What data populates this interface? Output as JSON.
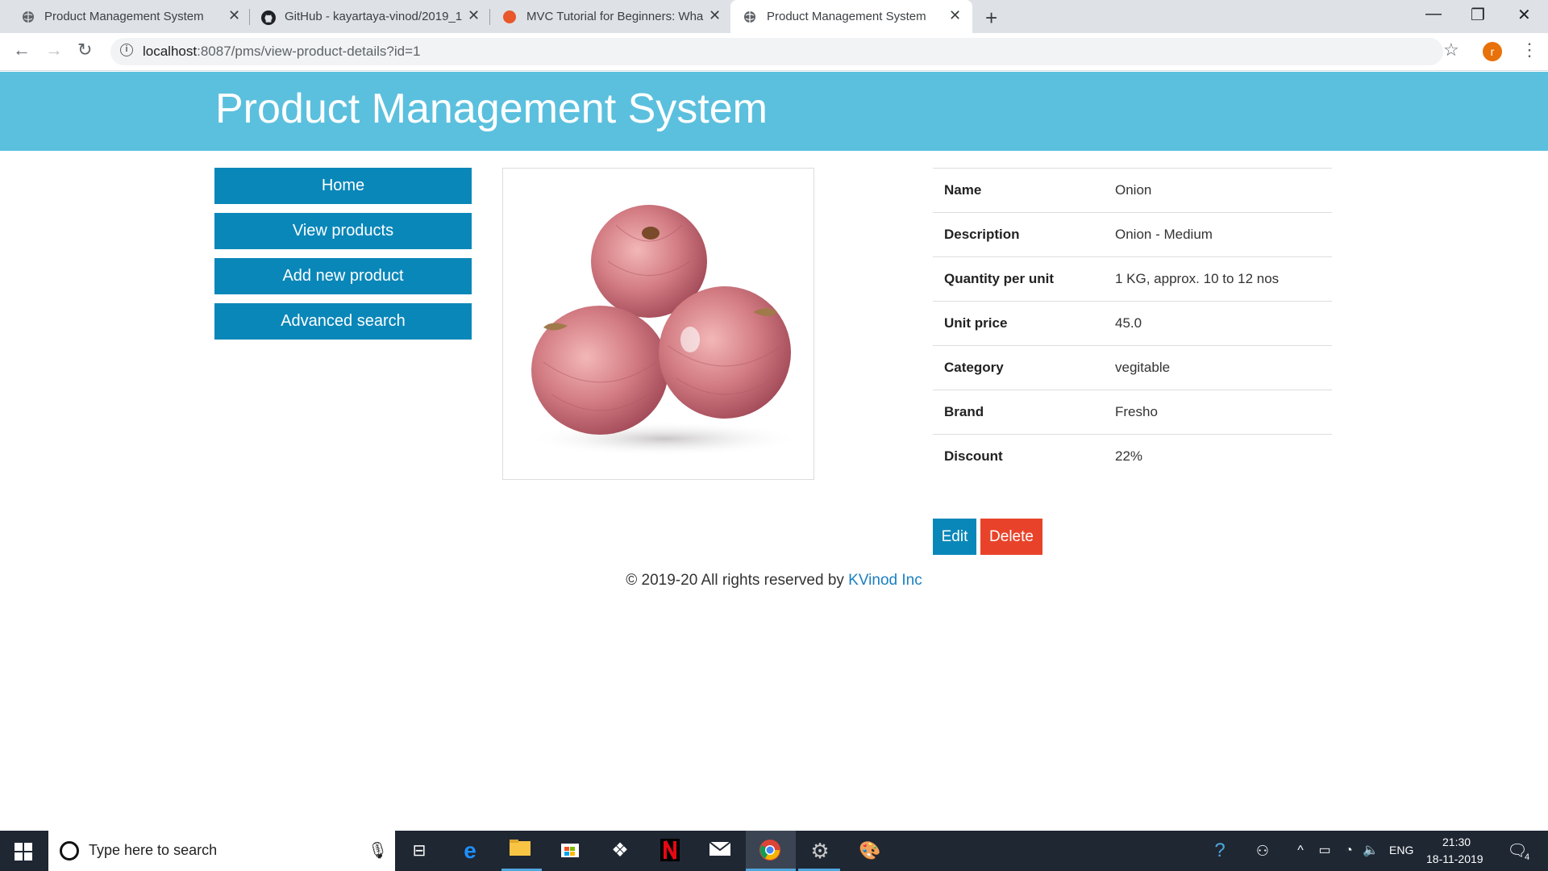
{
  "browser": {
    "tabs": [
      {
        "title": "Product Management System",
        "favicon": "globe-icon"
      },
      {
        "title": "GitHub - kayartaya-vinod/2019_1",
        "favicon": "github-icon"
      },
      {
        "title": "MVC Tutorial for Beginners: Wha",
        "favicon": "guru99-icon"
      },
      {
        "title": "Product Management System",
        "favicon": "globe-icon",
        "active": true
      }
    ],
    "url_host": "localhost",
    "url_rest": ":8087/pms/view-product-details?id=1",
    "profile_initial": "r"
  },
  "header": {
    "title": "Product Management System"
  },
  "sidebar": {
    "items": [
      {
        "label": "Home"
      },
      {
        "label": "View products"
      },
      {
        "label": "Add new product"
      },
      {
        "label": "Advanced search"
      }
    ]
  },
  "product": {
    "rows": [
      {
        "label": "Name",
        "value": "Onion"
      },
      {
        "label": "Description",
        "value": "Onion - Medium"
      },
      {
        "label": "Quantity per unit",
        "value": "1 KG, approx. 10 to 12 nos"
      },
      {
        "label": "Unit price",
        "value": "45.0"
      },
      {
        "label": "Category",
        "value": "vegitable"
      },
      {
        "label": "Brand",
        "value": "Fresho"
      },
      {
        "label": "Discount",
        "value": "22%"
      }
    ]
  },
  "actions": {
    "edit_label": "Edit",
    "delete_label": "Delete"
  },
  "footer": {
    "text": "© 2019-20 All rights reserved by ",
    "link": "KVinod Inc"
  },
  "taskbar": {
    "search_placeholder": "Type here to search",
    "language": "ENG",
    "time": "21:30",
    "date": "18-11-2019",
    "notification_count": "4"
  },
  "colors": {
    "header_bg": "#5bc0de",
    "primary_button": "#0a87b9",
    "danger_button": "#e8432a",
    "link": "#1a7fc1"
  }
}
